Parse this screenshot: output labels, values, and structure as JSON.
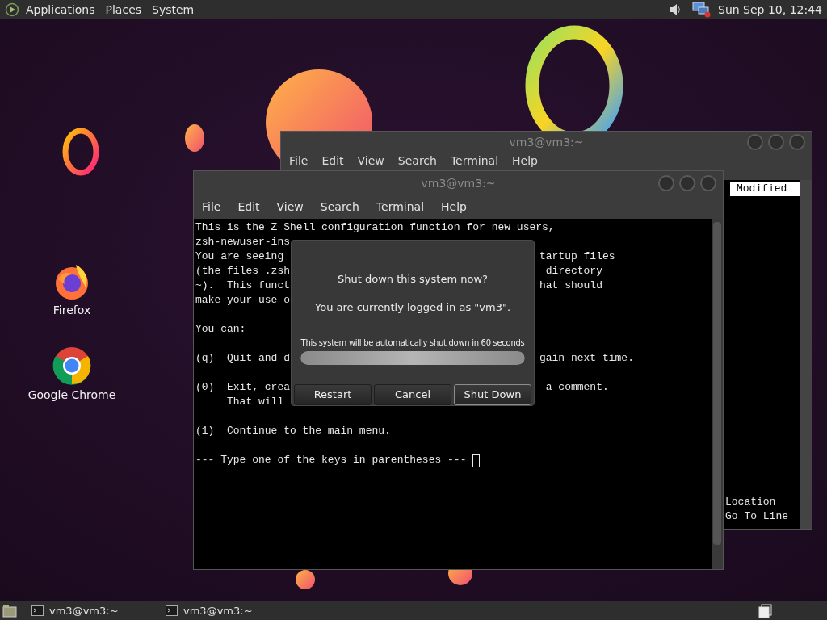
{
  "top_panel": {
    "menus": [
      "Applications",
      "Places",
      "System"
    ],
    "clock": "Sun Sep 10, 12:44"
  },
  "desktop_icons": [
    {
      "label": "Firefox",
      "kind": "firefox"
    },
    {
      "label": "Google Chrome",
      "kind": "chrome"
    }
  ],
  "back_window": {
    "title": "vm3@vm3:~",
    "menu": [
      "File",
      "Edit",
      "View",
      "Search",
      "Terminal",
      "Help"
    ],
    "header": "Modified",
    "lines": [
      "Location",
      "Go To Line"
    ]
  },
  "front_window": {
    "title": "vm3@vm3:~",
    "menu": [
      "File",
      "Edit",
      "View",
      "Search",
      "Terminal",
      "Help"
    ],
    "lines": [
      {
        "kind": "text",
        "text": "This is the Z Shell configuration function for new users,"
      },
      {
        "kind": "text",
        "text": "zsh-newuser-ins"
      },
      {
        "kind": "text",
        "text": "You are seeing ",
        "tail": "tartup files"
      },
      {
        "kind": "text",
        "text": "(the files .zsh",
        "tail": " directory"
      },
      {
        "kind": "text",
        "text": "~).  This funct",
        "tail": "hat should"
      },
      {
        "kind": "text",
        "text": "make your use o"
      },
      {
        "kind": "blank"
      },
      {
        "kind": "text",
        "text": "You can:"
      },
      {
        "kind": "blank"
      },
      {
        "kind": "text",
        "text": "(q)  Quit and d",
        "tail": "gain next time."
      },
      {
        "kind": "blank"
      },
      {
        "kind": "text",
        "text": "(0)  Exit, crea",
        "tail": " a comment."
      },
      {
        "kind": "text",
        "text": "     That will"
      },
      {
        "kind": "blank"
      },
      {
        "kind": "text",
        "text": "(1)  Continue to the main menu."
      },
      {
        "kind": "blank"
      },
      {
        "kind": "prompt",
        "text": "--- Type one of the keys in parentheses --- "
      }
    ]
  },
  "dialog": {
    "title": "Shut down this system now?",
    "message": "You are currently logged in as \"vm3\".",
    "countdown": "This system will be automatically shut down in 60 seconds",
    "progress": {
      "level": 1
    },
    "buttons": [
      {
        "label": "Restart",
        "focused": false
      },
      {
        "label": "Cancel",
        "focused": false
      },
      {
        "label": "Shut Down",
        "focused": true
      }
    ]
  },
  "taskbar": {
    "tasks": [
      {
        "label": "vm3@vm3:~"
      },
      {
        "label": "vm3@vm3:~"
      }
    ]
  }
}
